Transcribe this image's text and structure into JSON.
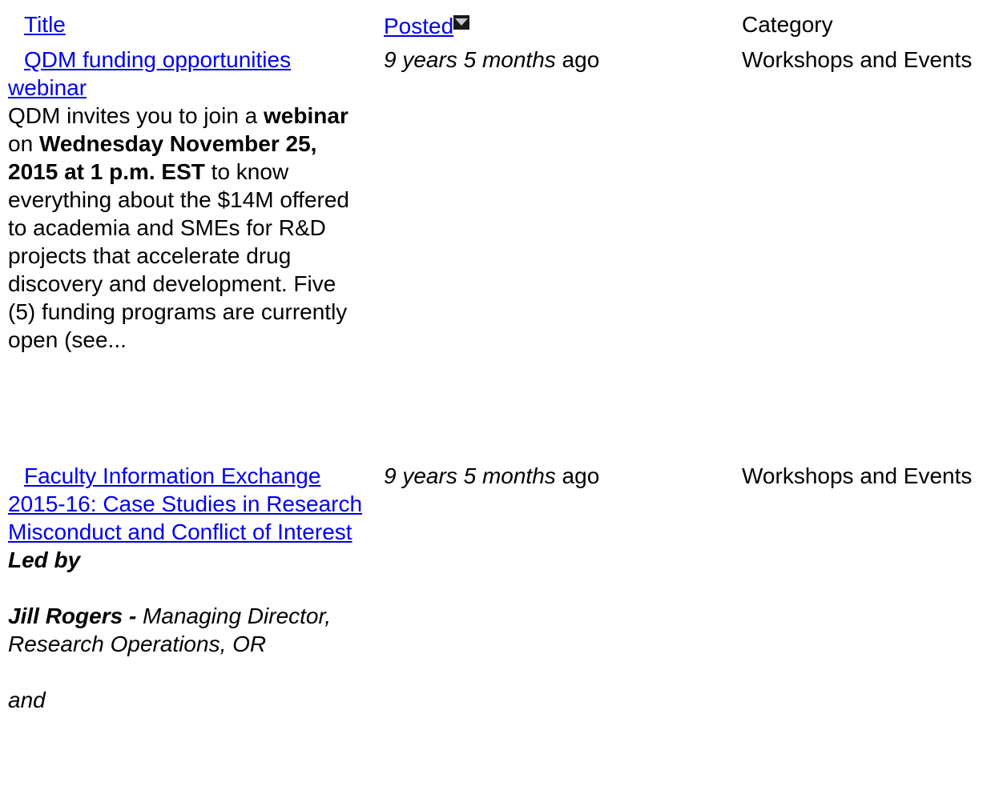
{
  "header": {
    "title_label": "Title",
    "posted_label": "Posted",
    "category_label": "Category",
    "sort_icon": "sort-descending-icon"
  },
  "rows": [
    {
      "title": "QDM funding opportunities webinar",
      "posted_italic": "9 years 5 months",
      "posted_suffix": " ago",
      "category": "Workshops and Events",
      "teaser": {
        "t1": "QDM invites you to join a ",
        "t2": "webinar",
        "t3": " on ",
        "t4": "Wednesday November 25, 2015 at 1 p.m. EST",
        "t5": " to know everything about the $14M offered to academia and SMEs for R&D projects that accelerate drug discovery and development. Five (5) funding programs are currently open (see..."
      }
    },
    {
      "title": "Faculty Information Exchange 2015-16: Case Studies in Research Misconduct and Conflict of Interest",
      "posted_italic": "9 years 5 months",
      "posted_suffix": " ago",
      "category": "Workshops and Events",
      "teaser": {
        "led_by": "Led by",
        "name": "Jill Rogers -",
        "role": " Managing Director, Research Operations, OR",
        "and": "and"
      }
    }
  ]
}
